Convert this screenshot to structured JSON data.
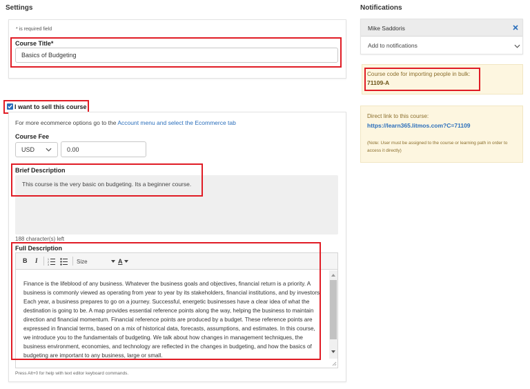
{
  "settings": {
    "title": "Settings",
    "required_note": "* is required field",
    "course_title_label": "Course Title*",
    "course_title_value": "Basics of Budgeting",
    "sell_label": "I want to sell this course",
    "sell_checked": true,
    "ecommerce_note_prefix": "For more ecommerce options go to the ",
    "ecommerce_note_link": "Account menu and select the Ecommerce tab",
    "course_fee_label": "Course Fee",
    "currency": "USD",
    "fee_value": "0.00",
    "brief_label": "Brief Description",
    "brief_value": "This course is the very basic on budgeting.  Its a beginner course.",
    "chars_left": "188 character(s) left",
    "full_label": "Full Description",
    "toolbar": {
      "bold": "B",
      "italic": "I",
      "size": "Size",
      "font_color": "A"
    },
    "full_text": "Finance is the lifeblood of any business. Whatever the business goals and objectives, financial return is a priority. A business is commonly viewed as operating from year to year by its stakeholders, financial institutions, and by investors. Each year, a business prepares to go on a journey. Successful, energetic businesses have a clear idea of what the destination is going to be. A map provides essential reference points along the way, helping the business to maintain direction and financial momentum. Financial reference points are produced by a budget. These reference points are expressed in financial terms, based on a mix of historical data, forecasts, assumptions, and estimates. In this course, we introduce you to the fundamentals of budgeting. We talk about how changes in management techniques, the business environment, economies, and technology are reflected in the changes in budgeting, and how the basics of budgeting are important to any business, large or small.",
    "help_text": "Press Alt+0 for help with text editor keyboard commands."
  },
  "notifications": {
    "title": "Notifications",
    "user": "Mike Saddoris",
    "add_placeholder": "Add to notifications",
    "course_code_label": "Course code for importing people in bulk:",
    "course_code": "71109-A",
    "direct_link_label": "Direct link to this course:",
    "direct_link": "https://learn365.litmos.com?C=71109",
    "note": "(Note: User must be assigned to the course or learning path in order to access it directly)"
  },
  "colors": {
    "accent": "#2a6ebb",
    "highlight": "#e01b24",
    "info_bg": "#fdf6e0"
  }
}
